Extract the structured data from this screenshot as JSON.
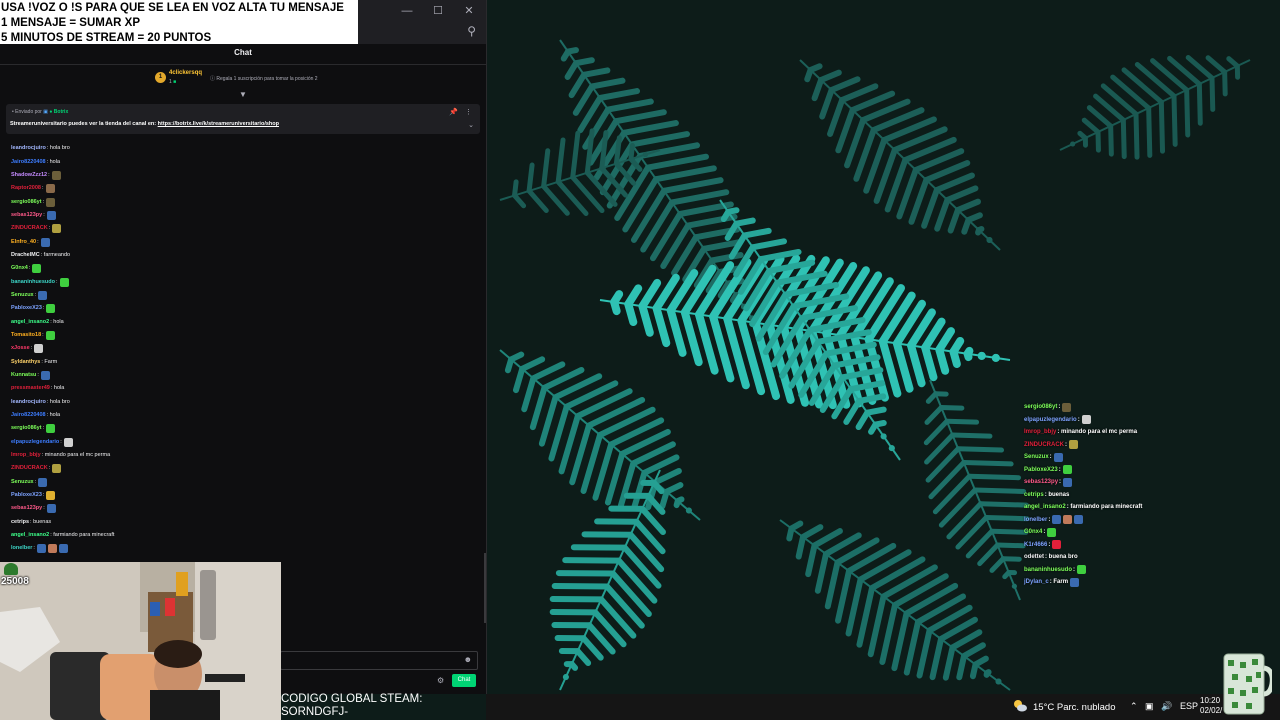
{
  "overlay": {
    "lines": [
      "USA !VOZ O !S PARA QUE SE LEA EN VOZ ALTA TU MENSAJE",
      "1 MENSAJE = SUMAR XP",
      "5 MINUTOS DE STREAM = 20 PUNTOS"
    ]
  },
  "chat": {
    "title": "Chat",
    "leaderboard": {
      "rank": "1",
      "user": "4clickersqq",
      "count": "1",
      "hint": "Regala 1 suscripción para tomar la posición 2"
    },
    "pinned": {
      "sent_by_label": "Enviado por",
      "bot_name": "Botrix",
      "message_prefix": "Streameruniversitario puedes ver la tienda del canal en: ",
      "link": "https://botrix.live/k/streameruniversitario/shop"
    },
    "messages": [
      {
        "user": "leandrocjuiro",
        "color": "#a3b8ff",
        "text": ": hola bro",
        "emotes": []
      },
      {
        "user": "Jairo8220408",
        "color": "#3d7dff",
        "text": ": hola",
        "emotes": []
      },
      {
        "user": "ShadowZzz12",
        "color": "#c58bff",
        "text": ":",
        "emotes": [
          "#6b5e3a"
        ]
      },
      {
        "user": "Raptor2008",
        "color": "#e0203a",
        "text": ":",
        "emotes": [
          "#8a6a4a"
        ]
      },
      {
        "user": "sergio086yt",
        "color": "#7dff5a",
        "text": ":",
        "emotes": [
          "#6b5e3a"
        ]
      },
      {
        "user": "sebas123py",
        "color": "#ff5a8a",
        "text": ":",
        "emotes": [
          "#3a6ab0"
        ]
      },
      {
        "user": "ZINDUCRACK",
        "color": "#e0203a",
        "text": ":",
        "emotes": [
          "#b0a040"
        ]
      },
      {
        "user": "Elnfro_40",
        "color": "#ffb020",
        "text": ":",
        "emotes": [
          "#3a6ab0"
        ]
      },
      {
        "user": "DrachelMC",
        "color": "#efeff1",
        "text": ": farmeando",
        "emotes": []
      },
      {
        "user": "G0nx4",
        "color": "#7dff5a",
        "text": ":",
        "emotes": [
          "#3fcf3f"
        ]
      },
      {
        "user": "bananinhuesudo",
        "color": "#3dd6c8",
        "text": ":",
        "emotes": [
          "#3fcf3f"
        ]
      },
      {
        "user": "Senuzux",
        "color": "#7dff5a",
        "text": ":",
        "emotes": [
          "#3a6ab0"
        ]
      },
      {
        "user": "PabloxeX23",
        "color": "#7da3ff",
        "text": ":",
        "emotes": [
          "#3fcf3f"
        ]
      },
      {
        "user": "angel_insano2",
        "color": "#3dff8a",
        "text": ": hola",
        "emotes": []
      },
      {
        "user": "Tomasito18",
        "color": "#ffb020",
        "text": ":",
        "emotes": [
          "#3fcf3f"
        ]
      },
      {
        "user": "xJosse",
        "color": "#ff3a6a",
        "text": ":",
        "emotes": [
          "#d0d0d0"
        ]
      },
      {
        "user": "Syldanthys",
        "color": "#ffd36a",
        "text": ": Farm",
        "emotes": []
      },
      {
        "user": "Kunnatsu",
        "color": "#7dff5a",
        "text": ":",
        "emotes": [
          "#3a6ab0"
        ]
      },
      {
        "user": "pressmaster49",
        "color": "#e0203a",
        "text": ": hola",
        "emotes": []
      },
      {
        "user": "leandrocjuiro",
        "color": "#a3b8ff",
        "text": ": hola bro",
        "emotes": []
      },
      {
        "user": "Jairo8220408",
        "color": "#3d7dff",
        "text": ": hola",
        "emotes": []
      },
      {
        "user": "sergio086yt",
        "color": "#7dff5a",
        "text": ":",
        "emotes": [
          "#3fcf3f"
        ]
      },
      {
        "user": "elpapuzlegendario",
        "color": "#3d7dff",
        "text": ":",
        "emotes": [
          "#d0d0d0"
        ]
      },
      {
        "user": "Imrop_bbjy",
        "color": "#e0203a",
        "text": ": minando para el mc perma",
        "emotes": []
      },
      {
        "user": "ZINDUCRACK",
        "color": "#e0203a",
        "text": ":",
        "emotes": [
          "#b0a040"
        ]
      },
      {
        "user": "Senuzux",
        "color": "#7dff5a",
        "text": ":",
        "emotes": [
          "#3a6ab0"
        ]
      },
      {
        "user": "PabloxeX23",
        "color": "#7da3ff",
        "text": ":",
        "emotes": [
          "#e0b030"
        ]
      },
      {
        "user": "sebas123py",
        "color": "#ff5a8a",
        "text": ":",
        "emotes": [
          "#3a6ab0"
        ]
      },
      {
        "user": "cetrips",
        "color": "#efeff1",
        "text": ": buenas",
        "emotes": []
      },
      {
        "user": "angel_insano2",
        "color": "#3dff8a",
        "text": ": farmiando para minecraft",
        "emotes": []
      },
      {
        "user": "lonelber",
        "color": "#3dd6c8",
        "text": ":",
        "emotes": [
          "#3a6ab0",
          "#c07a5a",
          "#3a6ab0"
        ]
      }
    ],
    "send_label": "Chat"
  },
  "webcam": {
    "follower_count": "25008"
  },
  "code": {
    "line1": "CODIGO GLOBAL STEAM:",
    "line2": "SORNDGFJ-"
  },
  "overlay_chat": [
    {
      "user": "sergio086yt",
      "color": "#7dff5a",
      "text": ":",
      "emotes": [
        "#6b5e3a"
      ]
    },
    {
      "user": "elpapuzlegendario",
      "color": "#7da3ff",
      "text": ":",
      "emotes": [
        "#d0d0d0"
      ]
    },
    {
      "user": "Imrop_bbjy",
      "color": "#e0203a",
      "text": ": minando para el mc perma",
      "emotes": []
    },
    {
      "user": "ZINDUCRACK",
      "color": "#e0203a",
      "text": ":",
      "emotes": [
        "#b0a040"
      ]
    },
    {
      "user": "Senuzux",
      "color": "#7dff5a",
      "text": ":",
      "emotes": [
        "#3a6ab0"
      ]
    },
    {
      "user": "PabloxeX23",
      "color": "#7dff5a",
      "text": ":",
      "emotes": [
        "#3fcf3f"
      ]
    },
    {
      "user": "sebas123py",
      "color": "#ff5a8a",
      "text": ":",
      "emotes": [
        "#3a6ab0"
      ]
    },
    {
      "user": "cetrips",
      "color": "#7dff5a",
      "text": ": buenas",
      "emotes": []
    },
    {
      "user": "angel_insano2",
      "color": "#7dff5a",
      "text": ": farmiando para minecraft",
      "emotes": []
    },
    {
      "user": "lonelber",
      "color": "#7da3ff",
      "text": ":",
      "emotes": [
        "#3a6ab0",
        "#c07a5a",
        "#3a6ab0"
      ]
    },
    {
      "user": "G0nx4",
      "color": "#7dff5a",
      "text": ":",
      "emotes": [
        "#3fcf3f"
      ]
    },
    {
      "user": "K1r4666",
      "color": "#7da3ff",
      "text": ":",
      "emotes": [
        "#e0203a"
      ]
    },
    {
      "user": "odettet",
      "color": "#efeff1",
      "text": ": buena bro",
      "emotes": []
    },
    {
      "user": "bananinhuesudo",
      "color": "#7dff5a",
      "text": ":",
      "emotes": [
        "#3fcf3f"
      ]
    },
    {
      "user": "jDylan_c",
      "color": "#7da3ff",
      "text": ": Farm",
      "emotes": [
        "#3a6ab0"
      ]
    }
  ],
  "taskbar": {
    "weather": "15°C  Parc. nublado",
    "language": "ESP",
    "time": "10:20",
    "date": "02/02/"
  }
}
